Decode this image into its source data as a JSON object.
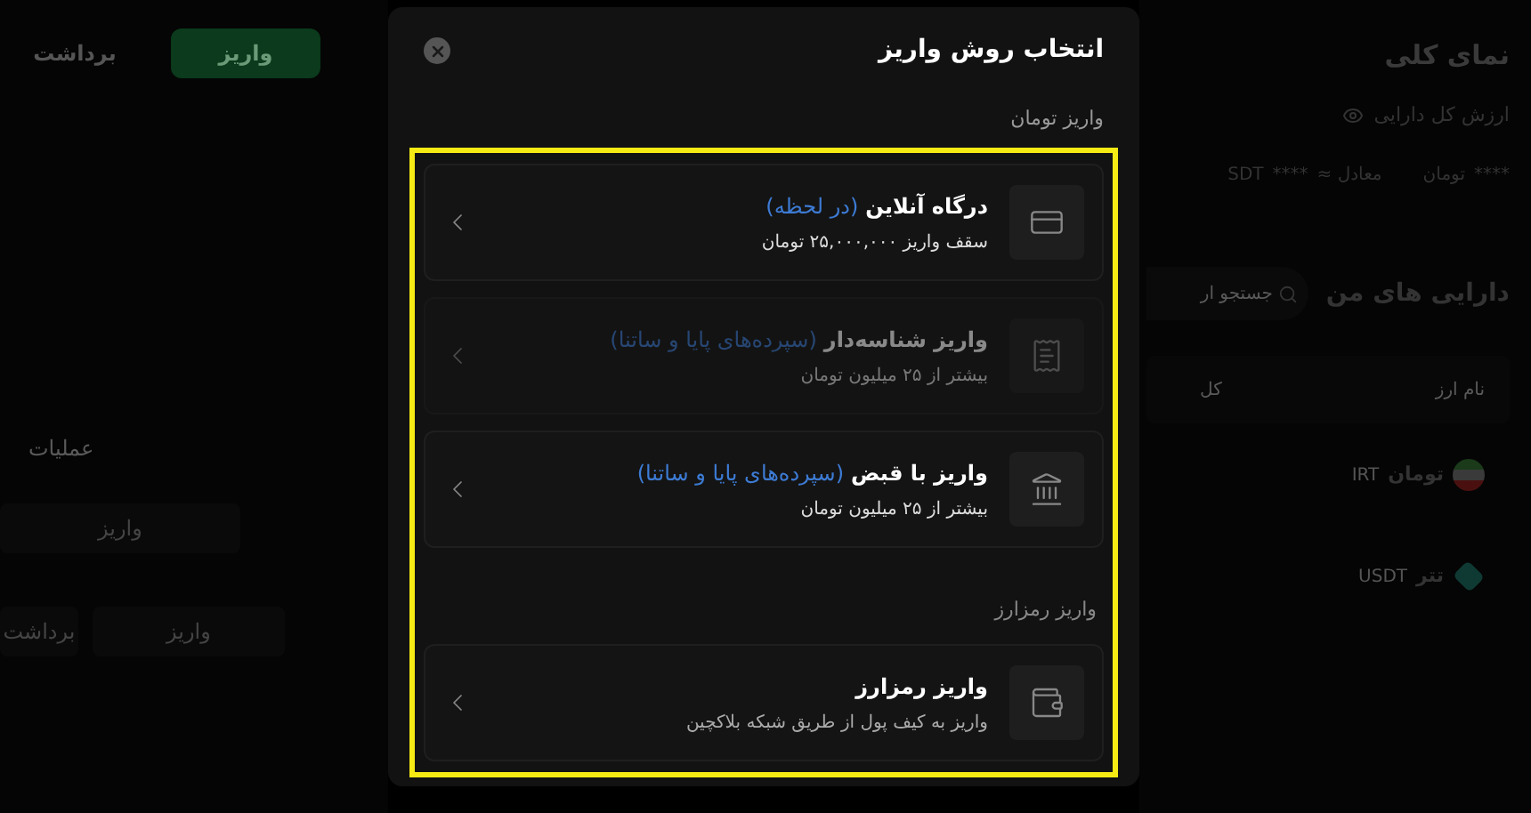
{
  "left_panel": {
    "top_buttons": [
      {
        "label": "واریز",
        "selected": true
      },
      {
        "label": "برداشت",
        "selected": false
      }
    ],
    "table_header": "عملیات",
    "rows": [
      {
        "buttons": [
          "واریز"
        ]
      },
      {
        "buttons": [
          "واریز",
          "برداشت"
        ]
      }
    ]
  },
  "modal": {
    "title": "انتخاب روش واریز",
    "sections": [
      {
        "heading": "واریز تومان",
        "methods": [
          {
            "kind": "card",
            "title": "درگاه آنلاین",
            "tag": "(در لحظه)",
            "subtitle": "سقف واریز ۲۵,۰۰۰,۰۰۰ تومان",
            "disabled": false
          },
          {
            "kind": "receipt",
            "title": "واریز شناسه‌دار",
            "tag": "(سپرده‌های پایا و ساتنا)",
            "subtitle": "بیشتر از ۲۵ میلیون تومان",
            "disabled": true
          },
          {
            "kind": "bank",
            "title": "واریز با قبض",
            "tag": "(سپرده‌های پایا و ساتنا)",
            "subtitle": "بیشتر از ۲۵ میلیون تومان",
            "disabled": false
          }
        ]
      },
      {
        "heading": "واریز رمزارز",
        "methods": [
          {
            "kind": "wallet",
            "title": "واریز رمزارز",
            "subtitle": "واریز به کیف پول از طریق شبکه بلاکچین",
            "disabled": false
          }
        ]
      }
    ]
  },
  "overview": {
    "title": "نمای کلی",
    "label": "ارزش کل دارایی",
    "toman_value": "****",
    "toman_unit": "تومان",
    "equiv_label": "معادل ≈",
    "usdt_value": "****",
    "usdt_unit": "SDT"
  },
  "assets": {
    "title": "دارایی های من",
    "search_placeholder": "جستجو ار",
    "columns": [
      "نام ارز",
      "کل"
    ],
    "rows": [
      {
        "kind": "flag",
        "name": "تومان",
        "symbol": "IRT"
      },
      {
        "kind": "tether",
        "name": "تتر",
        "symbol": "USDT"
      }
    ]
  }
}
